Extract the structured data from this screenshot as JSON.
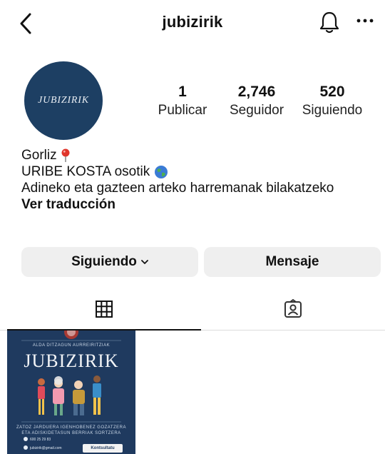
{
  "header": {
    "username": "jubizirik"
  },
  "profile": {
    "avatar_text": "JUBIZIRIK",
    "stats": {
      "posts": {
        "value": "1",
        "label": "Publicar"
      },
      "followers": {
        "value": "2,746",
        "label": "Seguidor"
      },
      "following": {
        "value": "520",
        "label": "Siguiendo"
      }
    },
    "bio": {
      "line1": "Gorliz",
      "line2": "URIBE KOSTA osotik",
      "line3": "Adineko eta gazteen arteko harremanak bilakatzeko",
      "translate_label": "Ver traducción"
    }
  },
  "actions": {
    "following_label": "Siguiendo",
    "message_label": "Mensaje"
  },
  "tabs": [
    {
      "name": "grid",
      "icon": "grid-icon",
      "active": true
    },
    {
      "name": "tagged",
      "icon": "tagged-person-icon",
      "active": false
    }
  ],
  "posts": [
    {
      "top_text": "ALDA DITZAGUN AURREIRITZIAK",
      "title": "JUBIZIRIK",
      "caption_line1": "ZATOZ JARDUERA IGENHOBENEZ GOZATZERA",
      "caption_line2": "ETA ADISKIDETASUN BERRIAK SORTZERA",
      "phone": "600 25 29 83",
      "email": "jubizirik@gmail.com",
      "button_label": "Kontsultatu"
    }
  ],
  "colors": {
    "avatar_bg": "#1d3f63",
    "button_bg": "#efefef",
    "poster_bg": "#1f3a5f"
  }
}
